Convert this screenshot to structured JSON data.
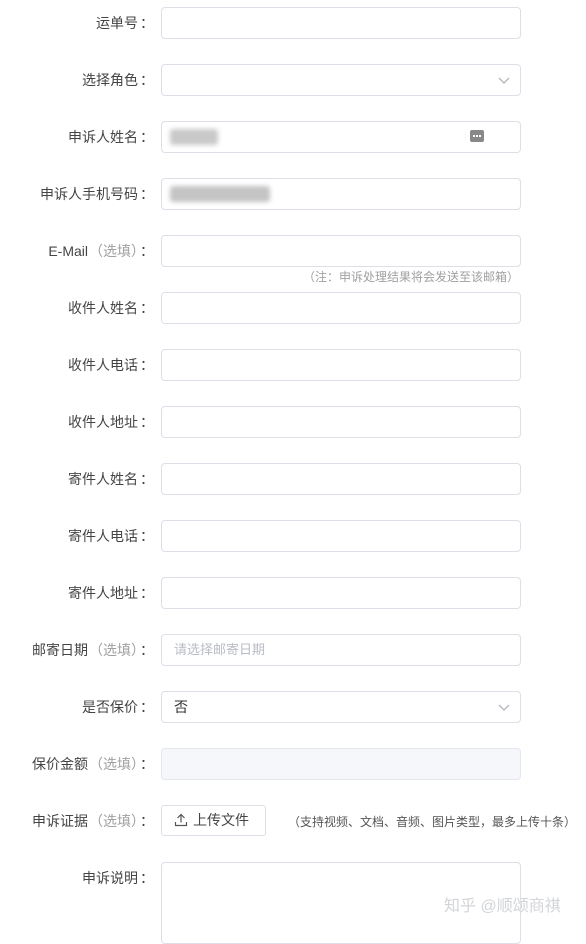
{
  "form": {
    "waybill": {
      "label": "运单号",
      "colon": "：",
      "value": ""
    },
    "role": {
      "label": "选择角色",
      "colon": "：",
      "value": ""
    },
    "complainant_name": {
      "label": "申诉人姓名",
      "colon": "："
    },
    "complainant_phone": {
      "label": "申诉人手机号码",
      "colon": "："
    },
    "email": {
      "label": "E-Mail",
      "optional": "（选填）",
      "colon": "：",
      "note": "（注：申诉处理结果将会发送至该邮箱）"
    },
    "recipient_name": {
      "label": "收件人姓名",
      "colon": "："
    },
    "recipient_phone": {
      "label": "收件人电话",
      "colon": "："
    },
    "recipient_address": {
      "label": "收件人地址",
      "colon": "："
    },
    "sender_name": {
      "label": "寄件人姓名",
      "colon": "："
    },
    "sender_phone": {
      "label": "寄件人电话",
      "colon": "："
    },
    "sender_address": {
      "label": "寄件人地址",
      "colon": "："
    },
    "mail_date": {
      "label": "邮寄日期",
      "optional": "（选填）",
      "colon": "：",
      "placeholder": "请选择邮寄日期"
    },
    "insured": {
      "label": "是否保价",
      "colon": "：",
      "value": "否"
    },
    "insured_amount": {
      "label": "保价金额",
      "optional": "（选填）",
      "colon": "："
    },
    "evidence": {
      "label": "申诉证据",
      "optional": "（选填）",
      "colon": "：",
      "button_label": "上传文件",
      "hint": "（支持视频、文档、音频、图片类型，最多上传十条）"
    },
    "description": {
      "label": "申诉说明",
      "colon": "："
    }
  },
  "icons": {
    "select_arrow": "chevron-down-icon",
    "upload": "upload-icon",
    "keyboard": "keyboard-icon"
  },
  "watermark": "知乎 @顺颂商祺",
  "colors": {
    "border": "#dcdfe6",
    "label": "#444444",
    "optional": "#a0a0a0",
    "placeholder": "#b8bcc4",
    "disabled_bg": "#f5f7fa"
  }
}
